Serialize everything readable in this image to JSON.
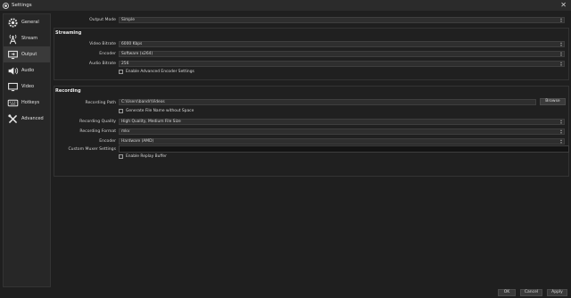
{
  "window": {
    "title": "Settings",
    "close_glyph": "✕"
  },
  "sidebar": {
    "items": [
      {
        "label": "General",
        "icon": "gear-icon",
        "active": false
      },
      {
        "label": "Stream",
        "icon": "broadcast-icon",
        "active": false
      },
      {
        "label": "Output",
        "icon": "monitor-output-icon",
        "active": true
      },
      {
        "label": "Audio",
        "icon": "speaker-icon",
        "active": false
      },
      {
        "label": "Video",
        "icon": "monitor-icon",
        "active": false
      },
      {
        "label": "Hotkeys",
        "icon": "keyboard-icon",
        "active": false
      },
      {
        "label": "Advanced",
        "icon": "wrench-screwdriver-icon",
        "active": false
      }
    ]
  },
  "output_mode": {
    "label": "Output Mode",
    "value": "Simple"
  },
  "streaming": {
    "title": "Streaming",
    "video_bitrate": {
      "label": "Video Bitrate",
      "value": "6000 Kbps"
    },
    "encoder": {
      "label": "Encoder",
      "value": "Software (x264)"
    },
    "audio_bitrate": {
      "label": "Audio Bitrate",
      "value": "256"
    },
    "advanced_encoder": {
      "label": "Enable Advanced Encoder Settings",
      "checked": false
    }
  },
  "recording": {
    "title": "Recording",
    "path": {
      "label": "Recording Path",
      "value": "C:\\Users\\bandr\\Videos",
      "browse_label": "Browse"
    },
    "no_space": {
      "label": "Generate File Name without Space",
      "checked": false
    },
    "quality": {
      "label": "Recording Quality",
      "value": "High Quality, Medium File Size"
    },
    "format": {
      "label": "Recording Format",
      "value": "mkv"
    },
    "encoder": {
      "label": "Encoder",
      "value": "Hardware (AMD)"
    },
    "muxer": {
      "label": "Custom Muxer Settings",
      "value": ""
    },
    "replay_buffer": {
      "label": "Enable Replay Buffer",
      "checked": false
    }
  },
  "footer": {
    "ok": "OK",
    "cancel": "Cancel",
    "apply": "Apply"
  },
  "colors": {
    "background": "#1f1f1f",
    "panel": "#272727",
    "field": "#2e2e2e",
    "active_item": "#3a3a3a"
  }
}
